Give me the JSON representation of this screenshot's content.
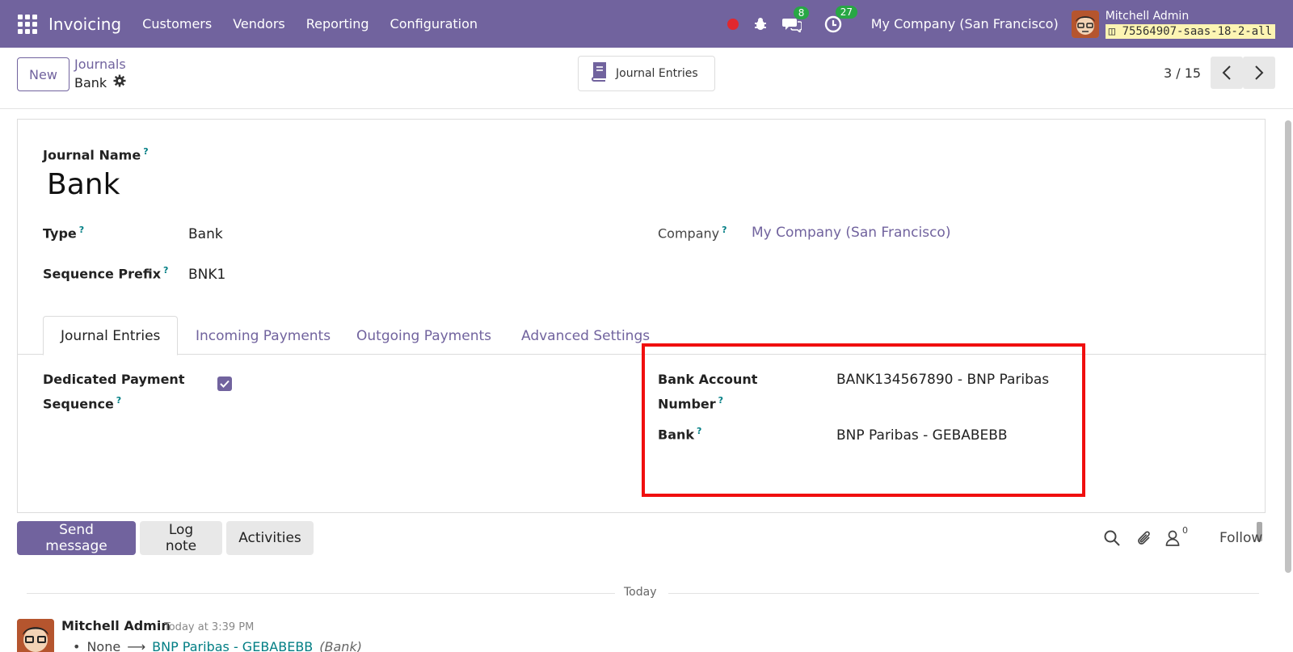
{
  "navbar": {
    "app_name": "Invoicing",
    "menu": [
      "Customers",
      "Vendors",
      "Reporting",
      "Configuration"
    ],
    "messages_count": "8",
    "activities_count": "27",
    "company": "My Company (San Francisco)",
    "user_name": "Mitchell Admin",
    "database": "75564907-saas-18-2-all"
  },
  "control": {
    "new_label": "New",
    "breadcrumb_parent": "Journals",
    "breadcrumb_current": "Bank",
    "smart_button": "Journal Entries",
    "pager": "3 / 15"
  },
  "form": {
    "journal_name_label": "Journal Name",
    "journal_name": "Bank",
    "type_label": "Type",
    "type_value": "Bank",
    "company_label": "Company",
    "company_value": "My Company (San Francisco)",
    "sequence_prefix_label": "Sequence Prefix",
    "sequence_prefix_value": "BNK1",
    "help_mark": "?"
  },
  "tabs": [
    "Journal Entries",
    "Incoming Payments",
    "Outgoing Payments",
    "Advanced Settings"
  ],
  "tab_content": {
    "dedicated_line1": "Dedicated Payment",
    "dedicated_line2": "Sequence",
    "dedicated_checked": true,
    "bank_account_line1": "Bank Account",
    "bank_account_line2": "Number",
    "bank_account_value": "BANK134567890 - BNP Paribas",
    "bank_label": "Bank",
    "bank_value": "BNP Paribas - GEBABEBB"
  },
  "chatter": {
    "send_message": "Send message",
    "log_note": "Log note",
    "activities": "Activities",
    "followers_count": "0",
    "follow": "Follow",
    "date_separator": "Today",
    "message": {
      "author": "Mitchell Admin",
      "time": "Today at 3:39 PM",
      "old_value": "None",
      "new_value": "BNP Paribas - GEBABEBB",
      "field": "(Bank)"
    }
  },
  "colors": {
    "brand": "#71639e",
    "highlight": "#f00f0f",
    "badge": "#28a745",
    "help": "#017e84"
  }
}
